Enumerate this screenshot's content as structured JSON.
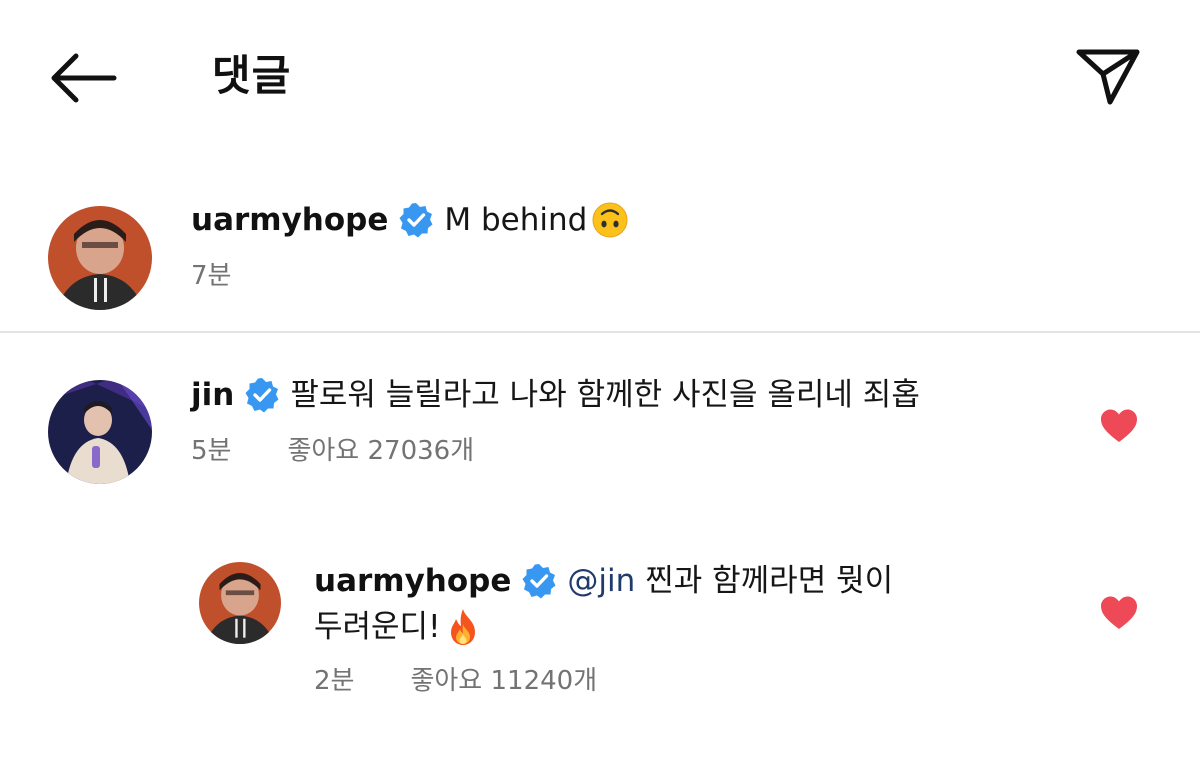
{
  "header": {
    "title": "댓글",
    "back_icon": "arrow-left-icon",
    "share_icon": "paper-plane-icon"
  },
  "colors": {
    "verified_badge": "#3897f0",
    "heart": "#ed4956",
    "meta_text": "#737373",
    "mention": "#203b6b"
  },
  "caption": {
    "username": "uarmyhope",
    "text": "M behind",
    "emoji": "upside-down-face",
    "time": "7분"
  },
  "comments": [
    {
      "username": "jin",
      "text": "팔로워 늘릴라고 나와 함께한 사진을 올리네 죄홉",
      "time": "5분",
      "likes": "좋아요 27036개",
      "liked": true
    }
  ],
  "reply": {
    "username": "uarmyhope",
    "mention": "@jin",
    "text_line1": "찐과 함께라면 뭣이",
    "text_line2": "두려운디!",
    "emoji": "fire",
    "time": "2분",
    "likes": "좋아요 11240개",
    "liked": true
  }
}
